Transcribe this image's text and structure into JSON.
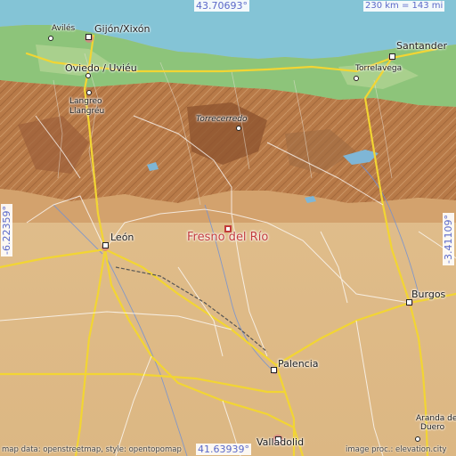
{
  "map": {
    "target": "Fresno del Río",
    "coords": {
      "lat_top": "43.70693°",
      "lat_bottom": "41.63939°",
      "lon_left": "-6.22359°",
      "lon_right": "-3.41109°"
    },
    "scale": "230 km = 143 mi",
    "credits": {
      "left": "map data: openstreetmap, style: opentopomap",
      "right": "image proc.: elevation.city"
    },
    "cities": {
      "aviles": "Avilés",
      "gijon": "Gijón/Xixón",
      "oviedo": "Oviedo / Uviéu",
      "langreo1": "Langreo",
      "langreo2": "Llangréu",
      "santander": "Santander",
      "torrelavega": "Torrelavega",
      "torrecerredo": "Torrecerredo",
      "leon": "León",
      "burgos": "Burgos",
      "palencia": "Palencia",
      "valladolid": "Valladolid",
      "aranda1": "Aranda de",
      "aranda2": "Duero"
    },
    "colors": {
      "sea": "#84c4d6",
      "lowland_green": "#8dc47a",
      "highland_brown": "#b87a48",
      "plateau": "#dfbb88",
      "roads": "#f2d533",
      "target": "#c23a3a",
      "coord_text": "#5b69c9"
    }
  }
}
